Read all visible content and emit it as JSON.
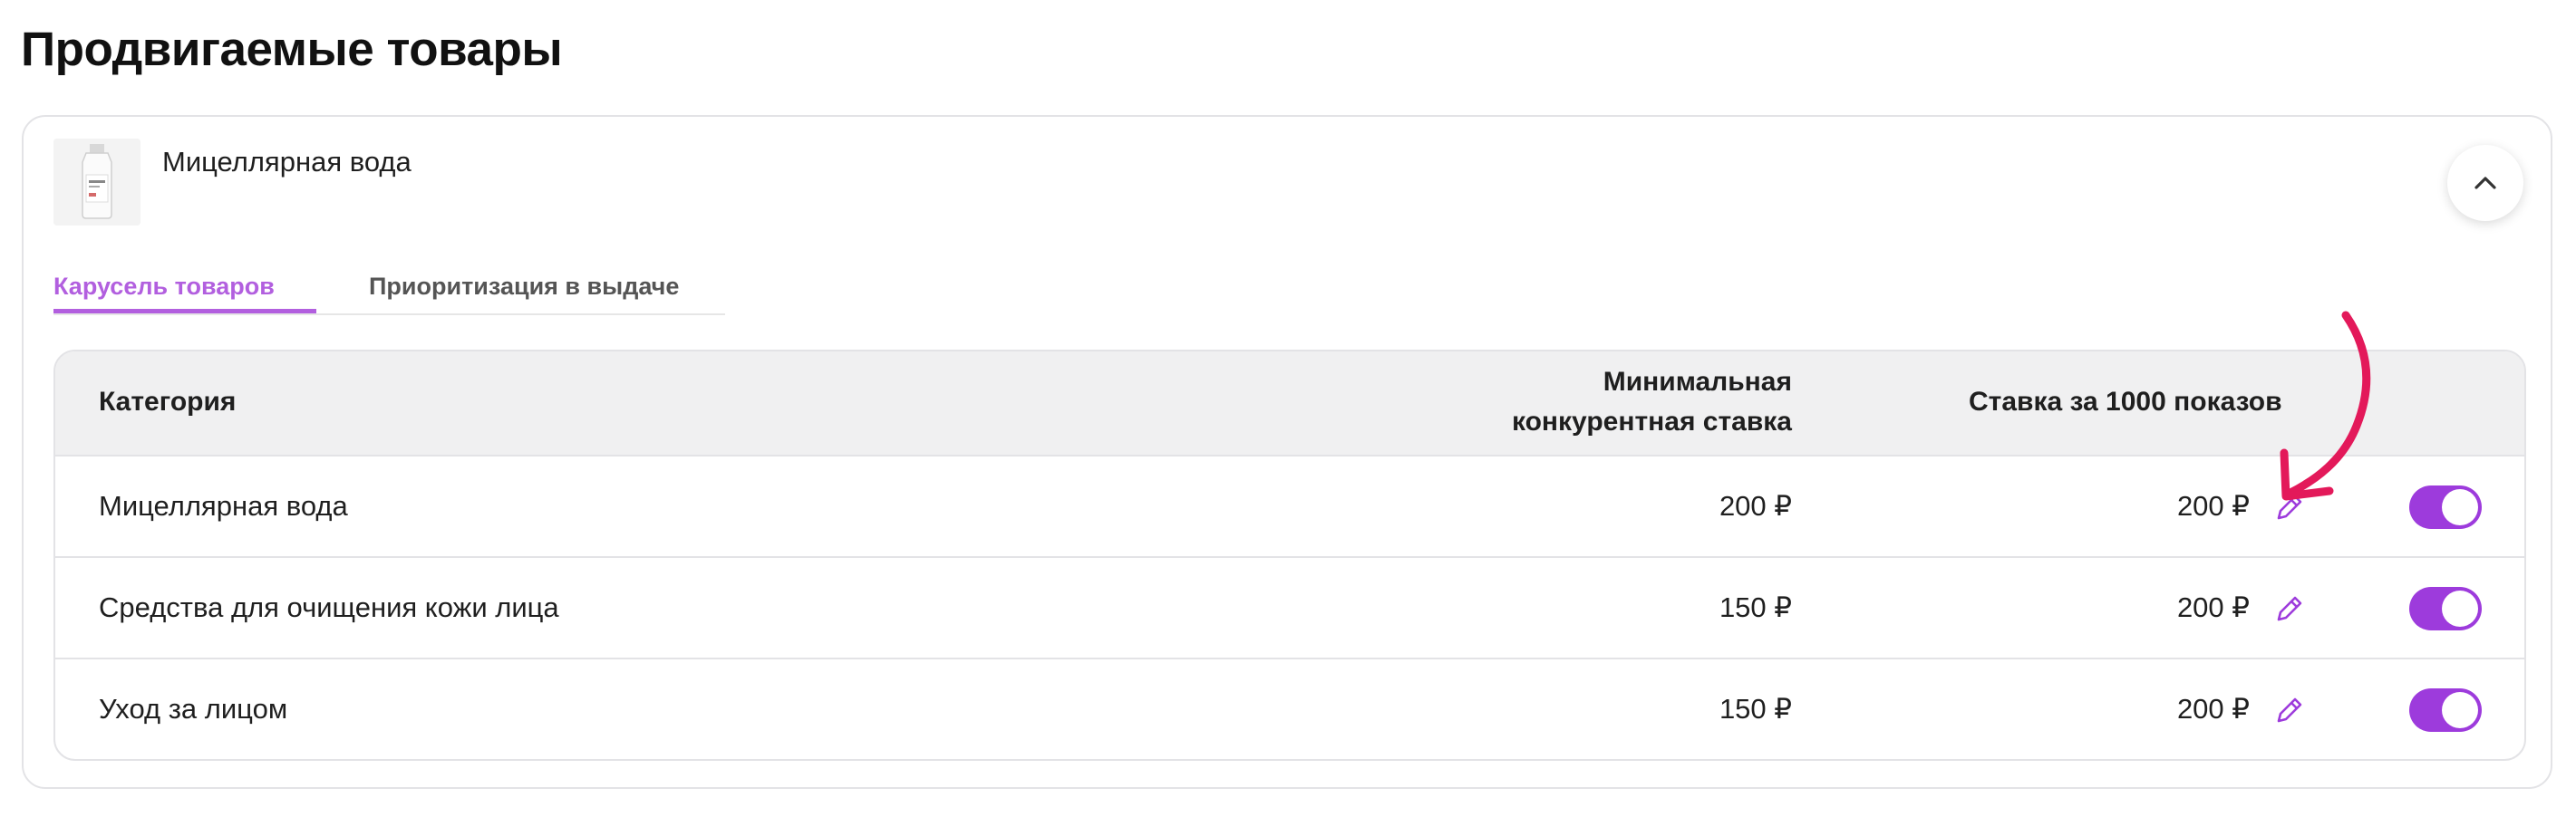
{
  "page": {
    "title": "Продвигаемые товары"
  },
  "product": {
    "name": "Мицеллярная вода",
    "thumbnail_icon": "product-bottle-image"
  },
  "tabs": [
    {
      "label": "Карусель товаров",
      "active": true
    },
    {
      "label": "Приоритизация в выдаче",
      "active": false
    }
  ],
  "table": {
    "headers": {
      "category": "Категория",
      "min_bid_line1": "Минимальная",
      "min_bid_line2": "конкурентная ставка",
      "bid": "Ставка за 1000 показов"
    },
    "rows": [
      {
        "category": "Мицеллярная вода",
        "min_bid": "200 ₽",
        "bid": "200 ₽",
        "enabled": true
      },
      {
        "category": "Средства для очищения кожи лица",
        "min_bid": "150 ₽",
        "bid": "200 ₽",
        "enabled": true
      },
      {
        "category": "Уход за лицом",
        "min_bid": "150 ₽",
        "bid": "200 ₽",
        "enabled": true
      }
    ]
  },
  "colors": {
    "accent": "#9d3bdc",
    "tab_active": "#b25fdf",
    "annotation_arrow": "#e3195a"
  }
}
